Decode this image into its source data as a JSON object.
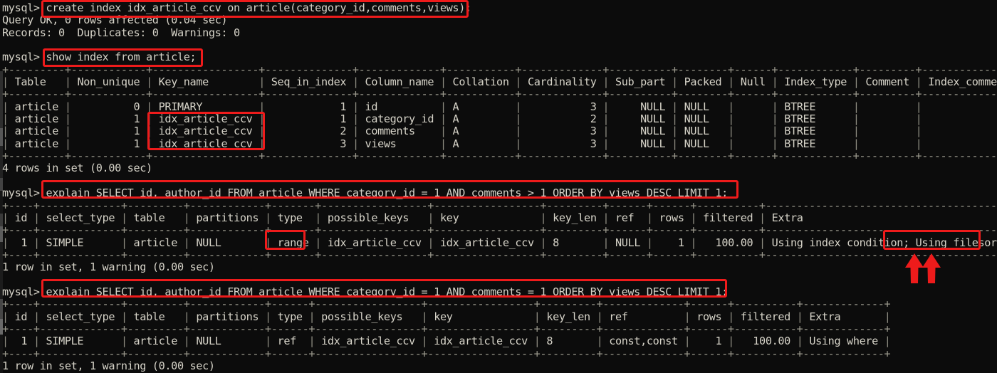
{
  "terminal": {
    "prompt": "mysql>",
    "background_color": "#0c0c0c",
    "text_color": "#d6d3c8",
    "highlight_color": "#ee1b1b",
    "lines": [
      "mysql> create index idx_article_ccv on article(category_id,comments,views);",
      "Query OK, 0 rows affected (0.04 sec)",
      "Records: 0  Duplicates: 0  Warnings: 0",
      "",
      "mysql> show index from article;",
      "+---------+------------+-----------------+--------------+-------------+-----------+-------------+----------+--------+------+------------+---------+---------------+",
      "| Table   | Non_unique | Key_name        | Seq_in_index | Column_name | Collation | Cardinality | Sub_part | Packed | Null | Index_type | Comment | Index_comment |",
      "+---------+------------+-----------------+--------------+-------------+-----------+-------------+----------+--------+------+------------+---------+---------------+",
      "| article |          0 | PRIMARY         |            1 | id          | A         |           3 |     NULL | NULL   |      | BTREE      |         |               |",
      "| article |          1 | idx_article_ccv |            1 | category_id | A         |           2 |     NULL | NULL   |      | BTREE      |         |               |",
      "| article |          1 | idx_article_ccv |            2 | comments    | A         |           3 |     NULL | NULL   |      | BTREE      |         |               |",
      "| article |          1 | idx_article_ccv |            3 | views       | A         |           3 |     NULL | NULL   |      | BTREE      |         |               |",
      "+---------+------------+-----------------+--------------+-------------+-----------+-------------+----------+--------+------+------------+---------+---------------+",
      "4 rows in set (0.00 sec)",
      "",
      "mysql> explain SELECT id, author_id FROM article WHERE category_id = 1 AND comments > 1 ORDER BY views DESC LIMIT 1;",
      "+----+-------------+---------+------------+-------+-----------------+-----------------+---------+------+------+----------+------------------------------------------+",
      "| id | select_type | table   | partitions | type  | possible_keys   | key             | key_len | ref  | rows | filtered | Extra                                    |",
      "+----+-------------+---------+------------+-------+-----------------+-----------------+---------+------+------+----------+------------------------------------------+",
      "|  1 | SIMPLE      | article | NULL       | range | idx_article_ccv | idx_article_ccv | 8       | NULL |    1 |   100.00 | Using index condition; Using filesort    |",
      "+----+-------------+---------+------------+-------+-----------------+-----------------+---------+------+------+----------+------------------------------------------+",
      "1 row in set, 1 warning (0.00 sec)",
      "",
      "mysql> explain SELECT id, author_id FROM article WHERE category_id = 1 AND comments = 1 ORDER BY views DESC LIMIT 1;",
      "+----+-------------+---------+------------+------+-----------------+-----------------+---------+-------------+------+----------+-------------+",
      "| id | select_type | table   | partitions | type | possible_keys   | key             | key_len | ref         | rows | filtered | Extra       |",
      "+----+-------------+---------+------------+------+-----------------+-----------------+---------+-------------+------+----------+-------------+",
      "|  1 | SIMPLE      | article | NULL       | ref  | idx_article_ccv | idx_article_ccv | 8       | const,const |    1 |   100.00 | Using where |",
      "+----+-------------+---------+------------+------+-----------------+-----------------+---------+-------------+------+----------+-------------+",
      "1 row in set, 1 warning (0.00 sec)"
    ],
    "commands": [
      "create index idx_article_ccv on article(category_id,comments,views);",
      "show index from article;",
      "explain SELECT id, author_id FROM article WHERE category_id = 1 AND comments > 1 ORDER BY views DESC LIMIT 1;",
      "explain SELECT id, author_id FROM article WHERE category_id = 1 AND comments = 1 ORDER BY views DESC LIMIT 1;"
    ],
    "results": {
      "create_index": {
        "status": "Query OK, 0 rows affected (0.04 sec)",
        "counters": "Records: 0  Duplicates: 0  Warnings: 0"
      },
      "show_index": {
        "columns": [
          "Table",
          "Non_unique",
          "Key_name",
          "Seq_in_index",
          "Column_name",
          "Collation",
          "Cardinality",
          "Sub_part",
          "Packed",
          "Null",
          "Index_type",
          "Comment",
          "Index_comment"
        ],
        "rows": [
          [
            "article",
            "0",
            "PRIMARY",
            "1",
            "id",
            "A",
            "3",
            "NULL",
            "NULL",
            "",
            "BTREE",
            "",
            ""
          ],
          [
            "article",
            "1",
            "idx_article_ccv",
            "1",
            "category_id",
            "A",
            "2",
            "NULL",
            "NULL",
            "",
            "BTREE",
            "",
            ""
          ],
          [
            "article",
            "1",
            "idx_article_ccv",
            "2",
            "comments",
            "A",
            "3",
            "NULL",
            "NULL",
            "",
            "BTREE",
            "",
            ""
          ],
          [
            "article",
            "1",
            "idx_article_ccv",
            "3",
            "views",
            "A",
            "3",
            "NULL",
            "NULL",
            "",
            "BTREE",
            "",
            ""
          ]
        ],
        "footer": "4 rows in set (0.00 sec)"
      },
      "explain_range": {
        "columns": [
          "id",
          "select_type",
          "table",
          "partitions",
          "type",
          "possible_keys",
          "key",
          "key_len",
          "ref",
          "rows",
          "filtered",
          "Extra"
        ],
        "rows": [
          [
            "1",
            "SIMPLE",
            "article",
            "NULL",
            "range",
            "idx_article_ccv",
            "idx_article_ccv",
            "8",
            "NULL",
            "1",
            "100.00",
            "Using index condition; Using filesort"
          ]
        ],
        "footer": "1 row in set, 1 warning (0.00 sec)"
      },
      "explain_ref": {
        "columns": [
          "id",
          "select_type",
          "table",
          "partitions",
          "type",
          "possible_keys",
          "key",
          "key_len",
          "ref",
          "rows",
          "filtered",
          "Extra"
        ],
        "rows": [
          [
            "1",
            "SIMPLE",
            "article",
            "NULL",
            "ref",
            "idx_article_ccv",
            "idx_article_ccv",
            "8",
            "const,const",
            "1",
            "100.00",
            "Using where"
          ]
        ],
        "footer": "1 row in set, 1 warning (0.00 sec)"
      }
    }
  },
  "annotations": {
    "boxes": [
      {
        "name": "highlight-create-index-command",
        "text": "create index idx_article_ccv on article(category_id,comments,views);"
      },
      {
        "name": "highlight-show-index-command",
        "text": "show index from article;"
      },
      {
        "name": "highlight-key-name-column",
        "text": "idx_article_ccv"
      },
      {
        "name": "highlight-explain-range-command",
        "text": "explain SELECT id, author_id FROM article WHERE category_id = 1 AND comments > 1 ORDER BY views DESC LIMIT 1;"
      },
      {
        "name": "highlight-type-range",
        "text": "range"
      },
      {
        "name": "highlight-using-filesort",
        "text": "Using filesort"
      },
      {
        "name": "highlight-explain-ref-command",
        "text": "explain SELECT id, author_id FROM article WHERE category_id = 1 AND comments = 1 ORDER BY views DESC LIMIT 1;"
      }
    ],
    "arrows": [
      {
        "name": "arrow-pointing-to-using-filesort-left",
        "direction": "up"
      },
      {
        "name": "arrow-pointing-to-using-filesort-right",
        "direction": "up"
      }
    ]
  }
}
